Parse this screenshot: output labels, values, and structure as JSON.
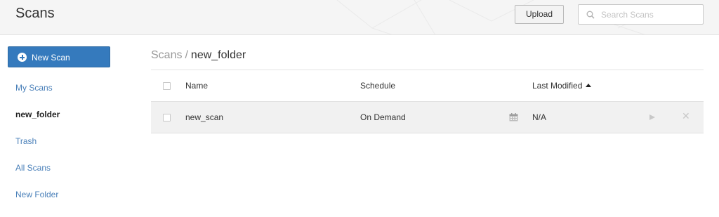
{
  "header": {
    "title": "Scans",
    "upload_label": "Upload",
    "search_placeholder": "Search Scans"
  },
  "sidebar": {
    "new_scan_label": "New Scan",
    "items": [
      {
        "label": "My Scans",
        "active": false
      },
      {
        "label": "new_folder",
        "active": true
      },
      {
        "label": "Trash",
        "active": false
      },
      {
        "label": "All Scans",
        "active": false
      },
      {
        "label": "New Folder",
        "active": false
      }
    ]
  },
  "breadcrumb": {
    "root": "Scans",
    "separator": "/",
    "current": "new_folder"
  },
  "table": {
    "columns": [
      "Name",
      "Schedule",
      "Last Modified"
    ],
    "sorted_column": "Last Modified",
    "sort_direction": "ascending",
    "rows": [
      {
        "name": "new_scan",
        "schedule": "On Demand",
        "last_modified": "N/A"
      }
    ]
  },
  "icons": {
    "new_scan": "plus-circle-icon",
    "search": "search-icon",
    "sort": "sort-up-icon",
    "schedule": "calendar-icon",
    "launch": "launch-icon",
    "delete": "delete-icon"
  },
  "colors": {
    "accent": "#357abd",
    "link": "#4a80b9",
    "row_background": "#f1f1f1",
    "header_background": "#f5f5f5"
  }
}
